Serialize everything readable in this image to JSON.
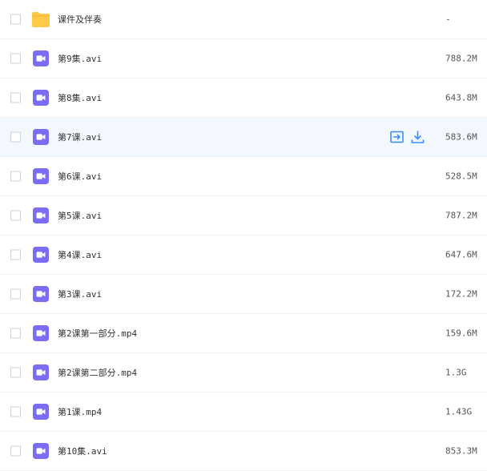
{
  "accent_color": "#3b8cff",
  "file_icon_colors": {
    "folder": "#ffc94c",
    "video": "#7a6cf3"
  },
  "rows": [
    {
      "name": "课件及伴奏",
      "size": "-",
      "type": "folder"
    },
    {
      "name": "第9集.avi",
      "size": "788.2M",
      "type": "video"
    },
    {
      "name": "第8集.avi",
      "size": "643.8M",
      "type": "video"
    },
    {
      "name": "第7课.avi",
      "size": "583.6M",
      "type": "video",
      "hovered": true,
      "actions": [
        "share-icon",
        "download-icon"
      ]
    },
    {
      "name": "第6课.avi",
      "size": "528.5M",
      "type": "video"
    },
    {
      "name": "第5课.avi",
      "size": "787.2M",
      "type": "video"
    },
    {
      "name": "第4课.avi",
      "size": "647.6M",
      "type": "video"
    },
    {
      "name": "第3课.avi",
      "size": "172.2M",
      "type": "video"
    },
    {
      "name": "第2课第一部分.mp4",
      "size": "159.6M",
      "type": "video"
    },
    {
      "name": "第2课第二部分.mp4",
      "size": "1.3G",
      "type": "video"
    },
    {
      "name": "第1课.mp4",
      "size": "1.43G",
      "type": "video"
    },
    {
      "name": "第10集.avi",
      "size": "853.3M",
      "type": "video"
    }
  ]
}
